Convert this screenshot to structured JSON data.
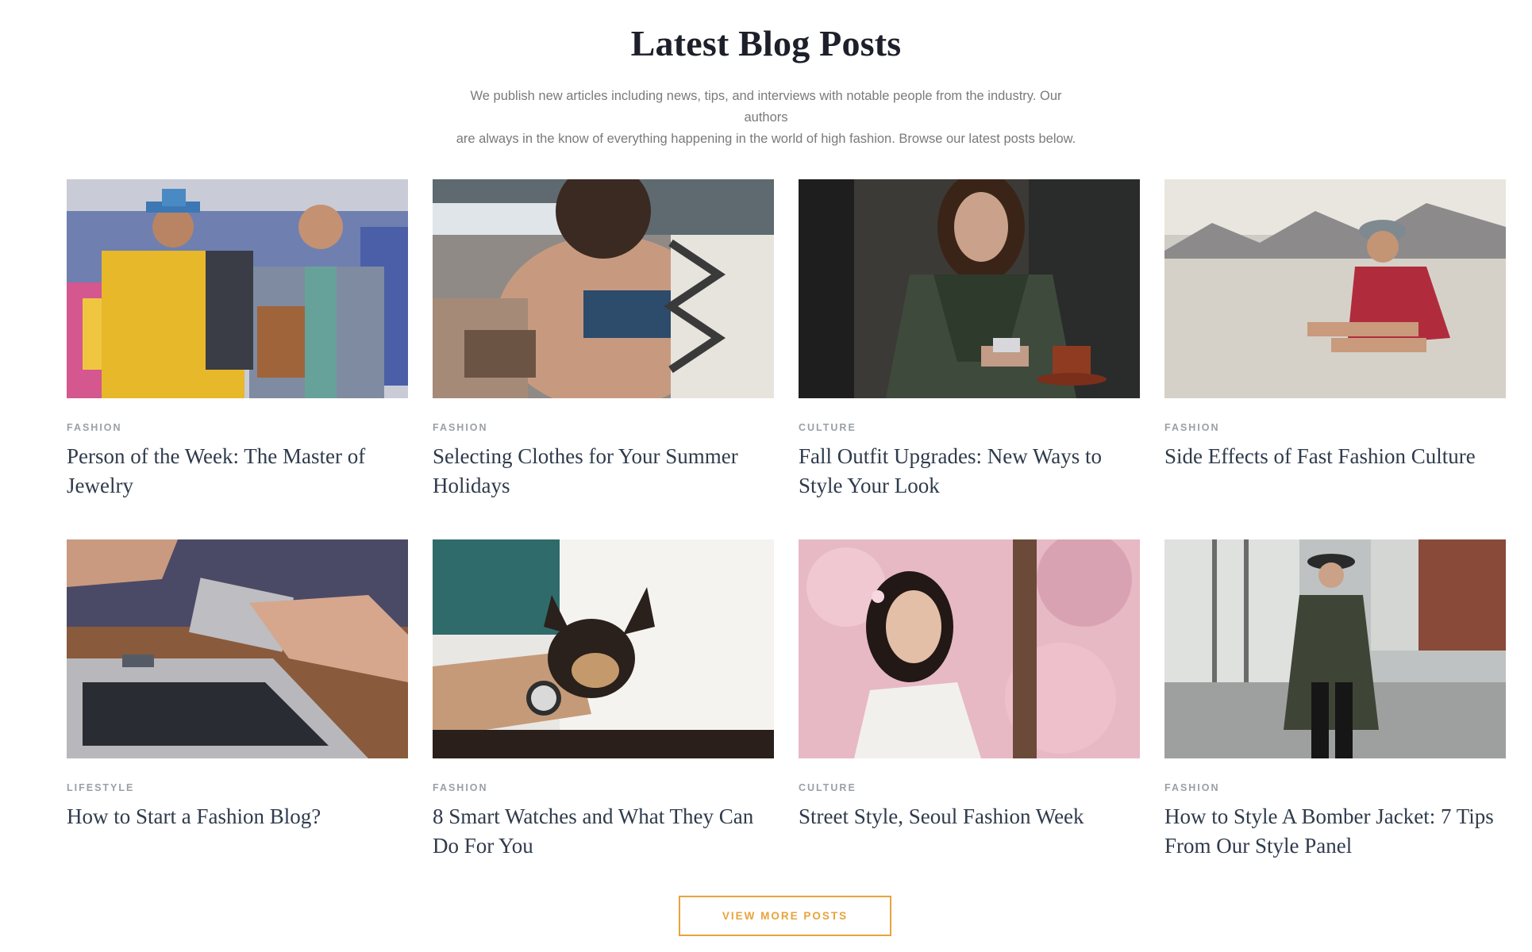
{
  "section": {
    "heading": "Latest Blog Posts",
    "intro_line1": "We publish new articles including news, tips, and interviews with notable people from the industry. Our authors",
    "intro_line2": "are always in the know of everything happening in the world of high fashion. Browse our latest posts below."
  },
  "posts": [
    {
      "category": "FASHION",
      "title": "Person of the Week: The Master of Jewelry",
      "image": "men-street-style-yellow-suit"
    },
    {
      "category": "FASHION",
      "title": "Selecting Clothes for Your Summer Holidays",
      "image": "woman-beach-lace-top"
    },
    {
      "category": "CULTURE",
      "title": "Fall Outfit Upgrades: New Ways to Style Your Look",
      "image": "woman-phone-coffee-cafe"
    },
    {
      "category": "FASHION",
      "title": "Side Effects of Fast Fashion Culture",
      "image": "woman-desert-hat"
    },
    {
      "category": "LIFESTYLE",
      "title": "How to Start a Fashion Blog?",
      "image": "hands-phone-laptop"
    },
    {
      "category": "FASHION",
      "title": "8 Smart Watches and What They Can Do For You",
      "image": "chihuahua-arm-watch"
    },
    {
      "category": "CULTURE",
      "title": "Street Style, Seoul Fashion Week",
      "image": "woman-cherry-blossom"
    },
    {
      "category": "FASHION",
      "title": "How to Style A Bomber Jacket: 7 Tips From Our Style Panel",
      "image": "woman-street-hat-jacket"
    }
  ],
  "cta": {
    "label": "VIEW MORE POSTS"
  },
  "colors": {
    "accent": "#e8a33c",
    "heading": "#1d1f2a",
    "title": "#2f3b4c",
    "muted": "#9aa0a6"
  }
}
